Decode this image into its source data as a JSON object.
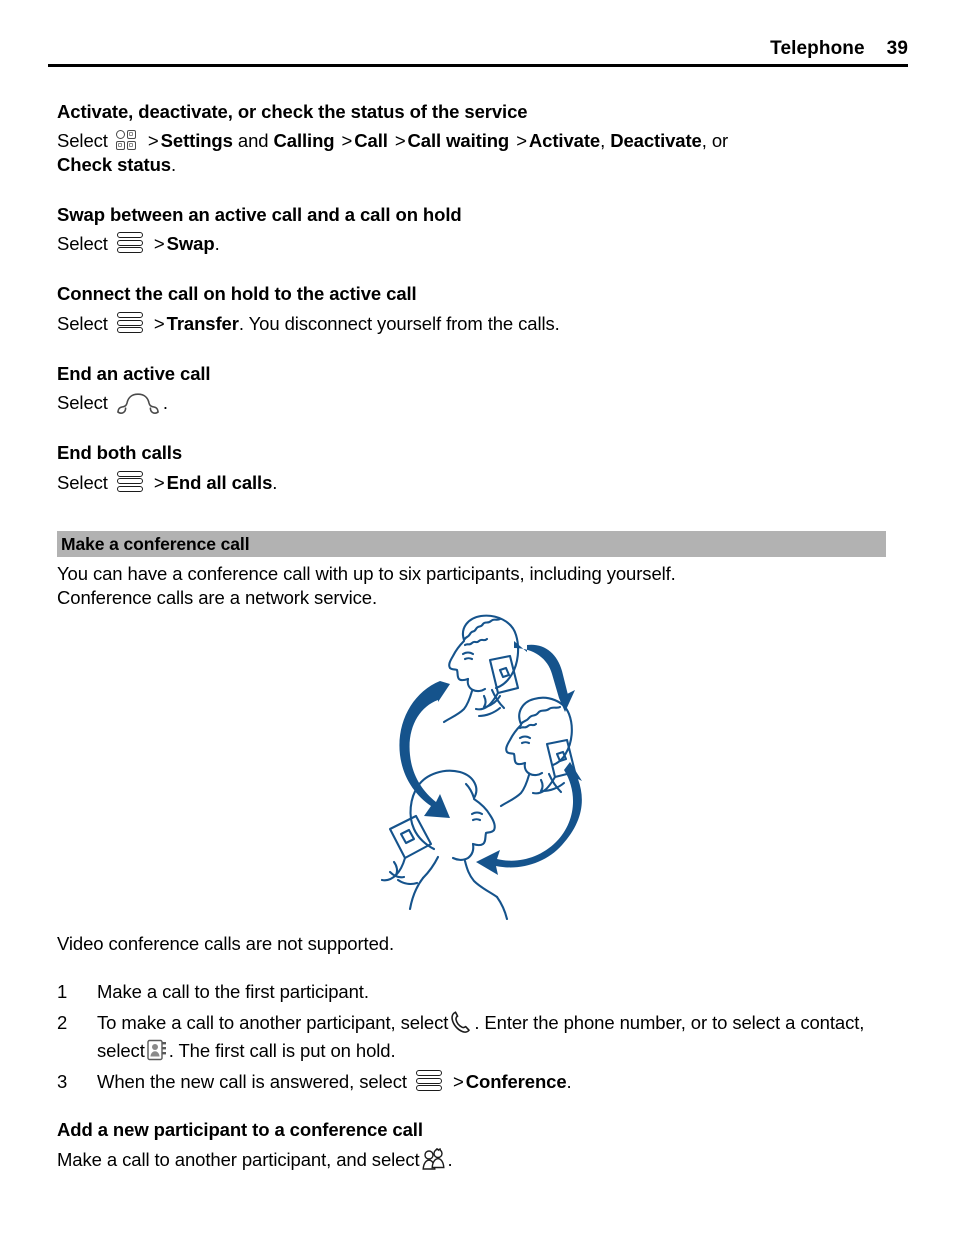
{
  "header": {
    "title": "Telephone",
    "page_number": "39"
  },
  "sections": [
    {
      "heading": "Activate, deactivate, or check the status of the service",
      "line1_prefix": "Select",
      "icon": "menu-grid-icon",
      "parts": [
        {
          "text": ">",
          "bold": false
        },
        {
          "text": "Settings",
          "bold": true
        },
        {
          "text": "and",
          "bold": false
        },
        {
          "text": "Calling",
          "bold": true
        },
        {
          "text": ">",
          "bold": false
        },
        {
          "text": "Call",
          "bold": true
        },
        {
          "text": ">",
          "bold": false
        },
        {
          "text": "Call waiting",
          "bold": true
        },
        {
          "text": ">",
          "bold": false
        },
        {
          "text": "Activate",
          "bold": true
        },
        {
          "text": ",",
          "bold": false
        },
        {
          "text": "Deactivate",
          "bold": true
        },
        {
          "text": ", or",
          "bold": false
        }
      ],
      "line2_bold": "Check status",
      "line2_suffix": "."
    },
    {
      "heading": "Swap between an active call and a call on hold",
      "line1_prefix": "Select",
      "icon": "options-menu-icon",
      "gt": ">",
      "bold_term": "Swap",
      "suffix": "."
    },
    {
      "heading": "Connect the call on hold to the active call",
      "line1_prefix": "Select",
      "icon": "options-menu-icon",
      "gt": ">",
      "bold_term": "Transfer",
      "suffix": ". You disconnect yourself from the calls."
    },
    {
      "heading": "End an active call",
      "line1_prefix": "Select",
      "icon": "end-call-icon",
      "suffix": "."
    },
    {
      "heading": "End both calls",
      "line1_prefix": "Select",
      "icon": "options-menu-icon",
      "gt": ">",
      "bold_term": "End all calls",
      "suffix": "."
    }
  ],
  "conference": {
    "band_title": "Make a conference call",
    "intro_line1": "You can have a conference call with up to six participants, including yourself.",
    "intro_line2": "Conference calls are a network service.",
    "illustration_alt": "Three people talking on mobile phones connected by circular arrows",
    "note": "Video conference calls are not supported.",
    "steps": [
      {
        "num": "1",
        "text": "Make a call to the first participant."
      },
      {
        "num": "2",
        "text_part1": "To make a call to another participant, select",
        "icon1": "call-handset-icon",
        "text_part2": ". Enter the phone number, or to select a contact, select",
        "icon2": "contacts-icon",
        "text_part3": ". The first call is put on hold."
      },
      {
        "num": "3",
        "text_part1": "When the new call is answered, select",
        "icon1": "options-menu-icon",
        "gt": ">",
        "bold_term": "Conference",
        "text_part2": "."
      }
    ]
  },
  "add_participant": {
    "heading": "Add a new participant to a conference call",
    "text_prefix": "Make a call to another participant, and select",
    "icon": "conference-people-icon",
    "text_suffix": "."
  },
  "colors": {
    "illustration_line": "#15538C",
    "band_background": "#B2B2B2",
    "text": "#000000",
    "icon_outline": "#4A4A4A"
  }
}
